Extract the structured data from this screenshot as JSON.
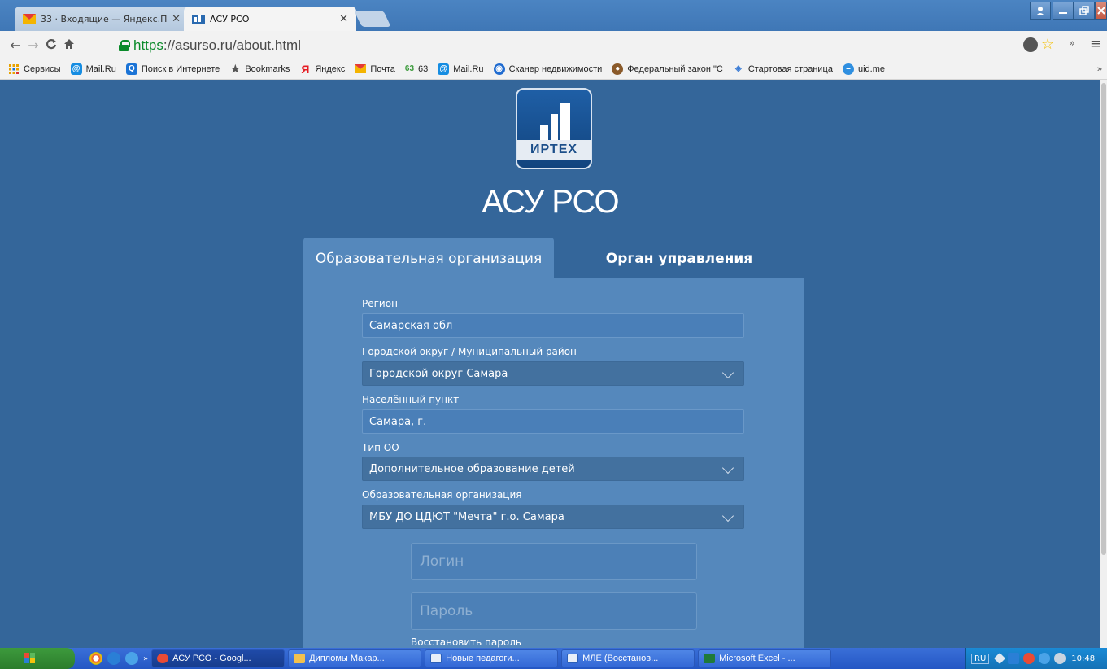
{
  "browser": {
    "tabs": [
      {
        "title": "33 · Входящие — Яндекс.П",
        "active": false
      },
      {
        "title": "АСУ РСО",
        "active": true
      }
    ],
    "url_scheme": "https",
    "url_rest": "://asurso.ru/about.html"
  },
  "bookmarks": [
    {
      "label": "Сервисы",
      "icon": "apps-grid-icon",
      "color": "#e8a200"
    },
    {
      "label": "Mail.Ru",
      "icon": "mailru-at-icon",
      "color": "#168de2"
    },
    {
      "label": "Поиск в Интернете",
      "icon": "search-icon",
      "color": "#1a73d6"
    },
    {
      "label": "Bookmarks",
      "icon": "star-icon",
      "color": "#555555"
    },
    {
      "label": "Яндекс",
      "icon": "yandex-icon",
      "color": "#e51c23"
    },
    {
      "label": "Почта",
      "icon": "mail-icon",
      "color": "#f4b400"
    },
    {
      "label": "63",
      "icon": "counter-63-icon",
      "color": "#3a9a3a",
      "badge": "63"
    },
    {
      "label": "Mail.Ru",
      "icon": "mailru-at-icon",
      "color": "#168de2"
    },
    {
      "label": "Сканер недвижимости",
      "icon": "scanner-icon",
      "color": "#1f6bd0"
    },
    {
      "label": "Федеральный закон \"С",
      "icon": "emblem-icon",
      "color": "#8a5a2a"
    },
    {
      "label": "Стартовая страница",
      "icon": "start-page-icon",
      "color": "#3a7bd5"
    },
    {
      "label": "uid.me",
      "icon": "uid-icon",
      "color": "#2f8fe0"
    }
  ],
  "page": {
    "logo_text": "ИРТЕХ",
    "app_title": "АСУ РСО",
    "tabs": {
      "edu": "Образовательная организация",
      "gov": "Орган управления"
    },
    "form": {
      "region_label": "Регион",
      "region_value": "Самарская обл",
      "district_label": "Городской округ / Муниципальный район",
      "district_value": "Городской округ Самара",
      "locality_label": "Населённый пункт",
      "locality_value": "Самара, г.",
      "type_label": "Тип ОО",
      "type_value": "Дополнительное образование детей",
      "org_label": "Образовательная организация",
      "org_value": "МБУ ДО ЦДЮТ \"Мечта\" г.о. Самара",
      "login_placeholder": "Логин",
      "password_placeholder": "Пароль",
      "restore_link": "Восстановить пароль"
    }
  },
  "taskbar": {
    "tasks": [
      {
        "label": "АСУ РСО - Googl...",
        "active": true,
        "color": "#e94b35"
      },
      {
        "label": "Дипломы Макар...",
        "active": false,
        "color": "#f2c14e"
      },
      {
        "label": "Новые педагоги...",
        "active": false,
        "color": "#2b5fb8"
      },
      {
        "label": "МЛЕ (Восстанов...",
        "active": false,
        "color": "#2b5fb8"
      },
      {
        "label": "Microsoft Excel - ...",
        "active": false,
        "color": "#1f7a3a"
      }
    ],
    "lang": "RU",
    "clock": "10:48"
  },
  "colors": {
    "page_bg": "#34669a",
    "panel_bg": "#5588bc",
    "url_secure": "#0a8a2a"
  }
}
